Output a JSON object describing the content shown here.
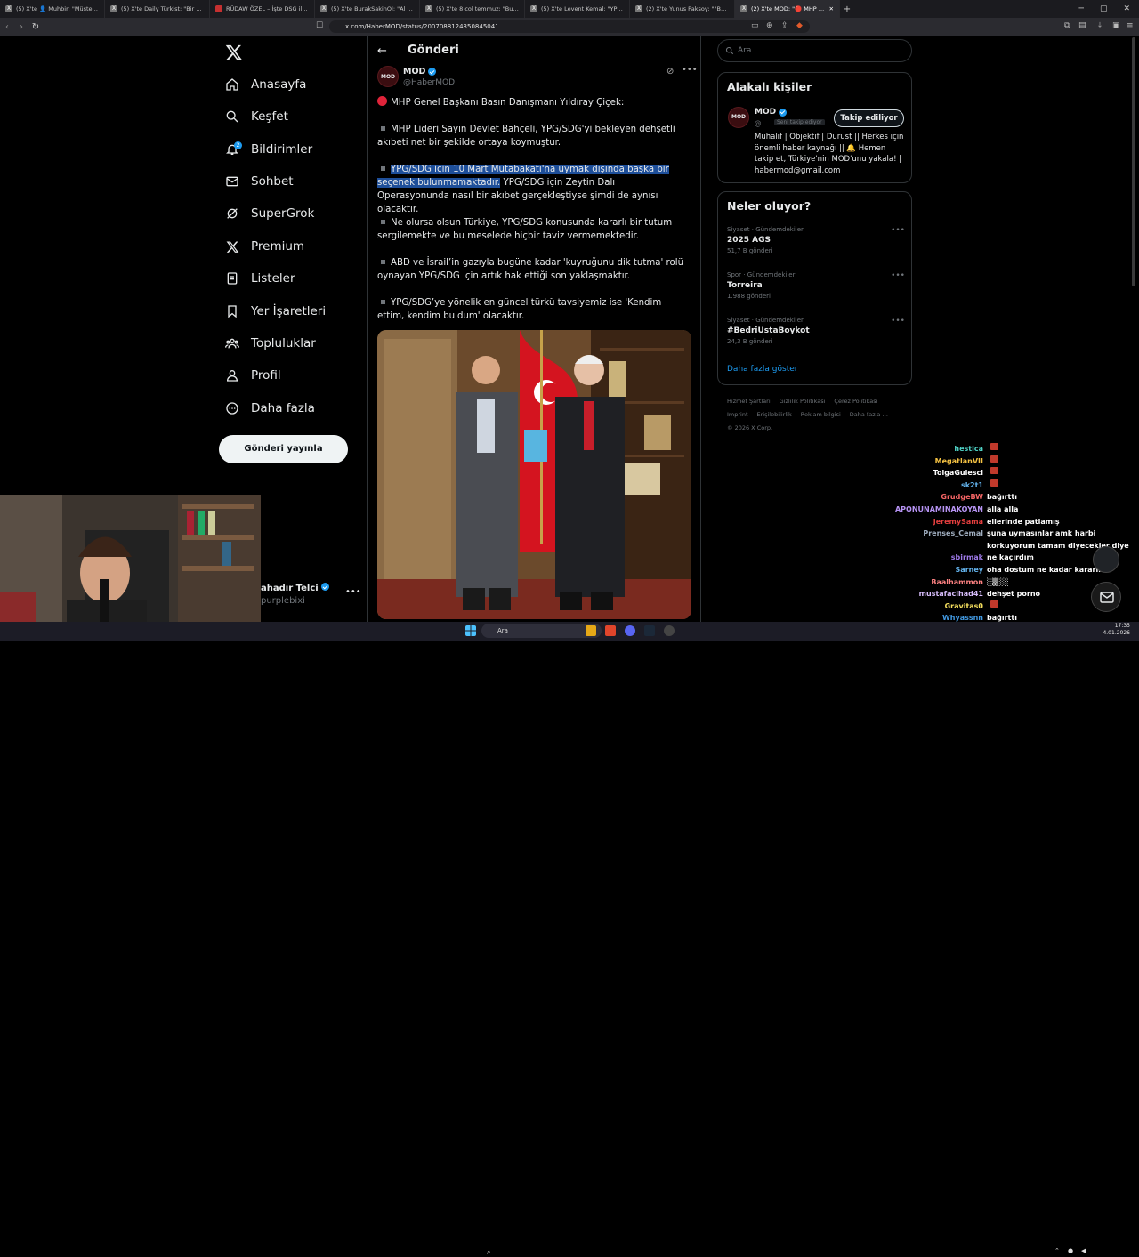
{
  "browser": {
    "tabs": [
      {
        "label": "(5) X'te 👤 Muhbir: \"Müşteriyle alay"
      },
      {
        "label": "(5) X'te Daily Türkist: \"Bir genç, \"Üks"
      },
      {
        "label": "RÜDAW ÖZEL – İşte DSG ile Şam aras"
      },
      {
        "label": "(5) X'te BurakSakinOl: \"Al Jazeera: SD"
      },
      {
        "label": "(5) X'te 8 col temmuz: \"Bugün SDG a"
      },
      {
        "label": "(5) X'te Levent Kemal: \"YPG/SDG ile"
      },
      {
        "label": "(2) X'te Yunus Paksoy: \"\"Bugün SDG"
      },
      {
        "label": "(2) X'te MOD: \"🔴 MHP Genel Baş"
      }
    ],
    "url": "x.com/HaberMOD/status/2007088124350845041"
  },
  "left_nav": {
    "items": [
      {
        "label": "Anasayfa"
      },
      {
        "label": "Keşfet"
      },
      {
        "label": "Bildirimler",
        "badge": "2"
      },
      {
        "label": "Sohbet"
      },
      {
        "label": "SuperGrok"
      },
      {
        "label": "Premium"
      },
      {
        "label": "Listeler"
      },
      {
        "label": "Yer İşaretleri"
      },
      {
        "label": "Topluluklar"
      },
      {
        "label": "Profil"
      },
      {
        "label": "Daha fazla"
      }
    ],
    "post_button": "Gönderi yayınla",
    "account": {
      "name": "ahadır Telci",
      "handle": "purplebixi",
      "more": "•••"
    }
  },
  "post": {
    "header_title": "Gönderi",
    "author_name": "MOD",
    "author_handle": "@HaberMOD",
    "avatar_text": "MOD",
    "more": "•••",
    "intro": "MHP Genel Başkanı Basın Danışmanı Yıldıray Çiçek:",
    "p1": "MHP Lideri Sayın Devlet Bahçeli, YPG/SDG'yi bekleyen dehşetli akıbeti net bir şekilde ortaya koymuştur.",
    "p2_highlight": "YPG/SDG için 10 Mart Mutabakatı'na uymak dışında başka bir seçenek bulunmamaktadır.",
    "p2_rest": " YPG/SDG için Zeytin Dalı Operasyonunda nasıl bir akıbet gerçekleştiyse şimdi de aynısı olacaktır.",
    "p3": "Ne olursa olsun Türkiye, YPG/SDG konusunda kararlı bir tutum sergilemekte ve bu meselede hiçbir taviz vermemektedir.",
    "p4": "ABD ve İsrail’in gazıyla bugüne kadar 'kuyruğunu dik tutma' rolü oynayan YPG/SDG için artık hak ettiği son yaklaşmaktır.",
    "p5": "YPG/SDG’ye yönelik en güncel türkü tavsiyemiz ise 'Kendim ettim, kendim buldum' olacaktır."
  },
  "right": {
    "search_placeholder": "Ara",
    "related": {
      "title": "Alakalı kişiler",
      "name": "MOD",
      "handle": "@...",
      "follows_you": "Seni takip ediyor",
      "follow_button": "Takip ediliyor",
      "bio": "Muhalif | Objektif | Dürüst || Herkes için önemli haber kaynağı || 🔔 Hemen takip et, Türkiye'nin MOD'unu yakala! | habermod@gmail.com"
    },
    "trends": {
      "title": "Neler oluyor?",
      "items": [
        {
          "meta": "Siyaset · Gündemdekiler",
          "name": "2025 AGS",
          "count": "51,7 B gönderi"
        },
        {
          "meta": "Spor · Gündemdekiler",
          "name": "Torreira",
          "count": "1.988 gönderi"
        },
        {
          "meta": "Siyaset · Gündemdekiler",
          "name": "#BedriUstaBoykot",
          "count": "24,3 B gönderi"
        }
      ],
      "show_more": "Daha fazla göster"
    },
    "footer": [
      "Hizmet Şartları",
      "Gizlilik Politikası",
      "Çerez Politikası",
      "Imprint",
      "Erişilebilirlik",
      "Reklam bilgisi",
      "Daha fazla …",
      "© 2026 X Corp."
    ]
  },
  "chat": [
    {
      "user": "hestica",
      "color": "#4fd1c5",
      "msg": ""
    },
    {
      "user": "MegatlanVII",
      "color": "#f6c343",
      "msg": ""
    },
    {
      "user": "TolgaGulesci",
      "color": "#ffffff",
      "msg": ""
    },
    {
      "user": "sk2t1",
      "color": "#63b3ed",
      "msg": ""
    },
    {
      "user": "GrudgeBW",
      "color": "#f56565",
      "msg": "bağırttı"
    },
    {
      "user": "APONUNAMINAKOYAN",
      "color": "#b794f4",
      "msg": "alla alla"
    },
    {
      "user": "JeremySama",
      "color": "#e53e3e",
      "msg": "ellerinde patlamış"
    },
    {
      "user": "Prenses_Cemal",
      "color": "#a0aec0",
      "msg": "şuna uymasınlar amk harbi"
    },
    {
      "user": "",
      "color": "#ffffff",
      "msg": "korkuyorum tamam diyecekler diye"
    },
    {
      "user": "sbirmak",
      "color": "#9f7aea",
      "msg": "ne kaçırdım"
    },
    {
      "user": "Sarney",
      "color": "#63b3ed",
      "msg": "oha dostum ne kadar kararlı"
    },
    {
      "user": "Baalhammon",
      "color": "#fc8181",
      "msg": "░▒░░"
    },
    {
      "user": "mustafacihad41",
      "color": "#d6bcfa",
      "msg": "dehşet porno"
    },
    {
      "user": "Gravitas0",
      "color": "#f6e05e",
      "msg": ""
    },
    {
      "user": "Whyassnn",
      "color": "#4299e1",
      "msg": "bağırttı"
    }
  ],
  "taskbar": {
    "search": "Ara",
    "time": "17:35",
    "date": "4.01.2026"
  }
}
